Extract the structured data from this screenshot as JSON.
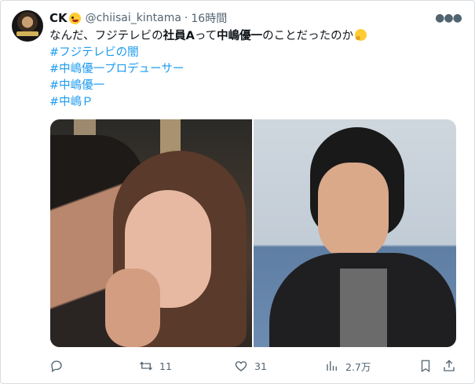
{
  "tweet": {
    "display_name": "CK",
    "name_emoji": "zany-face-icon",
    "handle": "@chiisai_kintama",
    "separator": "·",
    "time": "16時間",
    "text_line1_pre": "なんだ、フジテレビの",
    "text_line1_bold1": "社員A",
    "text_line1_mid": "って",
    "text_line1_bold2": "中嶋優一",
    "text_line1_post": "のことだったのか",
    "text_emoji": "thinking-face-icon",
    "hashtags": [
      "#フジテレビの闇",
      "#中嶋優一プロデューサー",
      "#中嶋優一",
      "#中嶋Ｐ"
    ]
  },
  "actions": {
    "reply_count": "",
    "retweet_count": "11",
    "like_count": "31",
    "views_count": "2.7万"
  }
}
